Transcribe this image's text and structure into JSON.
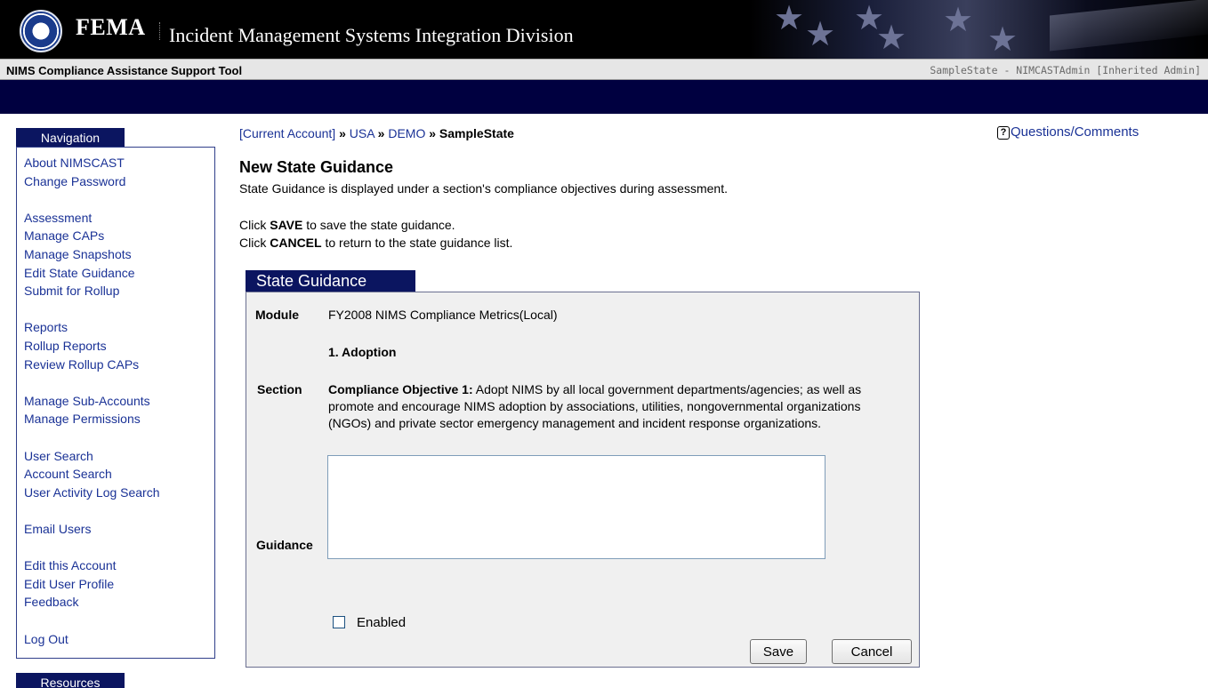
{
  "header": {
    "brand": "FEMA",
    "division": "Incident Management Systems Integration Division",
    "tool_title": "NIMS Compliance Assistance Support Tool",
    "user_info": "SampleState - NIMCASTAdmin [Inherited Admin]",
    "logo_icon": "dhs-seal-icon"
  },
  "sidebar": {
    "nav_title": "Navigation",
    "resources_title": "Resources",
    "groups": [
      [
        "About NIMSCAST",
        "Change Password"
      ],
      [
        "Assessment",
        "Manage CAPs",
        "Manage Snapshots",
        "Edit State Guidance",
        "Submit for Rollup"
      ],
      [
        "Reports",
        "Rollup Reports",
        "Review Rollup CAPs"
      ],
      [
        "Manage Sub-Accounts",
        "Manage Permissions"
      ],
      [
        "User Search",
        "Account Search",
        "User Activity Log Search"
      ],
      [
        "Email Users"
      ],
      [
        "Edit this Account",
        "Edit User Profile",
        "Feedback"
      ],
      [
        "Log Out"
      ]
    ]
  },
  "breadcrumb": {
    "items": [
      "[Current Account]",
      "USA",
      "DEMO",
      "SampleState"
    ],
    "separator": "»"
  },
  "help": {
    "label": "Questions/Comments",
    "icon": "question-icon",
    "icon_glyph": "?"
  },
  "main": {
    "title": "New State Guidance",
    "description": "State Guidance is displayed under a section's compliance objectives during assessment.",
    "instructions": [
      {
        "prefix": "Click ",
        "keyword": "SAVE",
        "suffix": " to save the state guidance."
      },
      {
        "prefix": "Click ",
        "keyword": "CANCEL",
        "suffix": " to return to the state guidance list."
      }
    ]
  },
  "form": {
    "tab_label": "State Guidance",
    "module_label": "Module",
    "module_value": "FY2008 NIMS Compliance Metrics(Local)",
    "section_heading": "1. Adoption",
    "section_label": "Section",
    "objective_label": "Compliance Objective 1:",
    "objective_text": " Adopt NIMS by all local government departments/agencies; as well as promote and encourage NIMS adoption by associations, utilities, nongovernmental organizations (NGOs) and private sector emergency management and incident response organizations.",
    "guidance_label": "Guidance",
    "guidance_value": "",
    "enabled_label": "Enabled",
    "enabled_checked": false,
    "save_label": "Save",
    "cancel_label": "Cancel"
  },
  "colors": {
    "navy": "#0b1560",
    "link": "#1a3296",
    "header_band": "#000040"
  }
}
